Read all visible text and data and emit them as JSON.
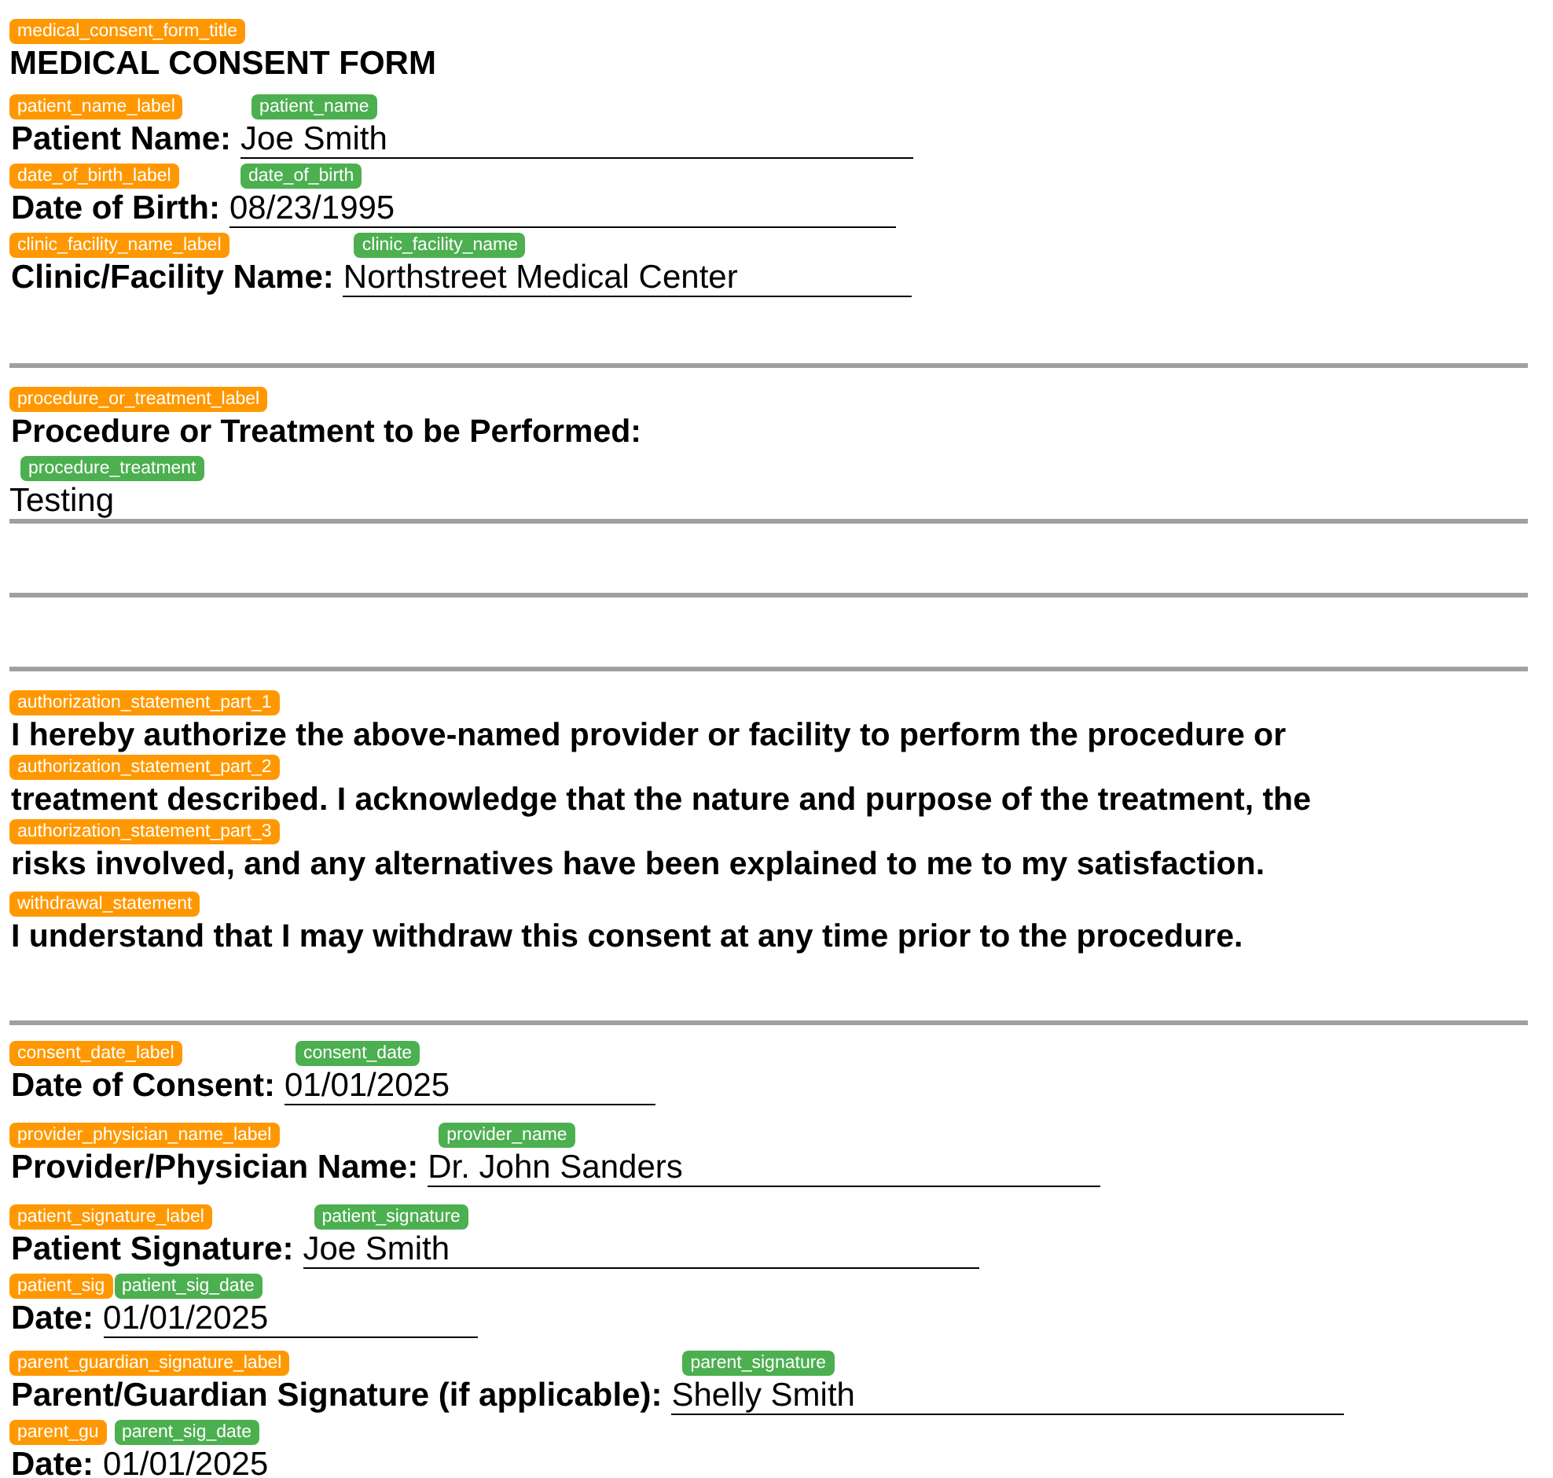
{
  "items": [
    {
      "kind": "title",
      "text": "MEDICAL CONSENT FORM",
      "tag": "medical_consent_form_title"
    },
    {
      "kind": "field",
      "label": "Patient Name:",
      "label_tag": "patient_name_label",
      "value": "Joe Smith",
      "value_tag": "patient_name"
    },
    {
      "kind": "field",
      "label": "Date of Birth:",
      "label_tag": "date_of_birth_label",
      "value": "08/23/1995",
      "value_tag": "date_of_birth"
    },
    {
      "kind": "field",
      "label": "Clinic/Facility Name:",
      "label_tag": "clinic_facility_name_label",
      "value": "Northstreet Medical Center",
      "value_tag": "clinic_facility_name"
    },
    {
      "kind": "rule"
    },
    {
      "kind": "heading",
      "text": "Procedure or Treatment to be Performed:",
      "tag": "procedure_or_treatment_label"
    },
    {
      "kind": "value",
      "text": "Testing",
      "tag": "procedure_treatment"
    },
    {
      "kind": "rule"
    },
    {
      "kind": "rule"
    },
    {
      "kind": "rule"
    },
    {
      "kind": "heading",
      "text": "I hereby authorize the above-named provider or facility to perform the procedure or",
      "tag": "authorization_statement_part_1"
    },
    {
      "kind": "heading",
      "text": "treatment described. I acknowledge that the nature and purpose of the treatment, the",
      "tag": "authorization_statement_part_2"
    },
    {
      "kind": "heading",
      "text": "risks involved, and any alternatives have been explained to me to my satisfaction.",
      "tag": "authorization_statement_part_3"
    },
    {
      "kind": "heading",
      "text": "I understand that I may withdraw this consent at any time prior to the procedure.",
      "tag": "withdrawal_statement"
    },
    {
      "kind": "rule"
    },
    {
      "kind": "field",
      "label": "Date of Consent:",
      "label_tag": "consent_date_label",
      "value": "01/01/2025",
      "value_tag": "consent_date"
    },
    {
      "kind": "field",
      "label": "Provider/Physician Name:",
      "label_tag": "provider_physician_name_label",
      "value": "Dr. John Sanders",
      "value_tag": "provider_name"
    },
    {
      "kind": "field",
      "label": "Patient Signature:",
      "label_tag": "patient_signature_label",
      "value": "Joe Smith",
      "value_tag": "patient_signature"
    },
    {
      "kind": "field",
      "label": "Date:",
      "label_tag": "patient_sig",
      "value": "01/01/2025",
      "value_tag": "patient_sig_date"
    },
    {
      "kind": "field",
      "label": "Parent/Guardian Signature (if applicable):",
      "label_tag": "parent_guardian_signature_label",
      "value": "Shelly Smith",
      "value_tag": "parent_signature"
    },
    {
      "kind": "field",
      "label": "Date:",
      "label_tag": "parent_gu",
      "value": "01/01/2025",
      "value_tag": "parent_sig_date"
    }
  ]
}
